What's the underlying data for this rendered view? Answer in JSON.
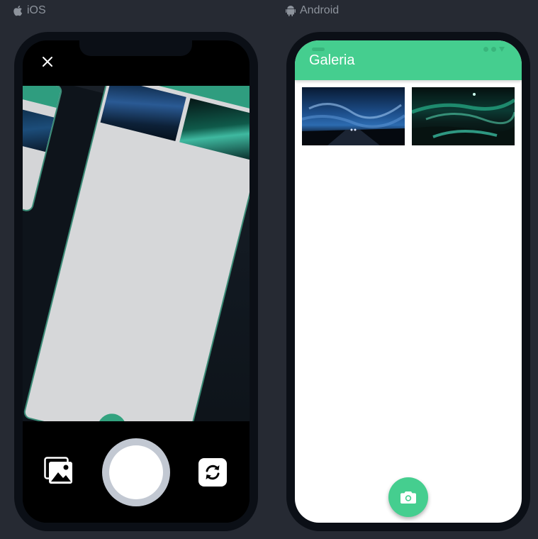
{
  "labels": {
    "ios": "iOS",
    "android": "Android"
  },
  "android_app": {
    "title": "Galeria",
    "photos": [
      {
        "name": "night-sky-road"
      },
      {
        "name": "aurora-lake"
      }
    ]
  },
  "icons": {
    "ios_label": "apple-icon",
    "android_label": "android-icon",
    "close": "close-icon",
    "gallery": "image-gallery-icon",
    "flip": "camera-switch-icon",
    "fab": "camera-icon"
  },
  "colors": {
    "background": "#262a33",
    "accent_green": "#45ce8f",
    "phone_frame": "#0b0f16"
  }
}
